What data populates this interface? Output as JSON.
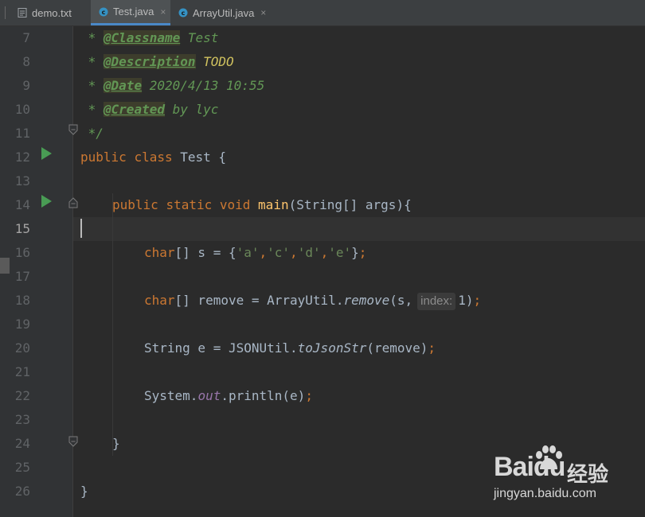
{
  "tabs": [
    {
      "label": "demo.txt",
      "icon": "text-file-icon",
      "active": false
    },
    {
      "label": "Test.java",
      "icon": "java-class-icon",
      "active": true
    },
    {
      "label": "ArrayUtil.java",
      "icon": "java-class-icon",
      "active": false
    }
  ],
  "tab_close_glyph": "×",
  "line_numbers": [
    "7",
    "8",
    "9",
    "10",
    "11",
    "12",
    "13",
    "14",
    "15",
    "16",
    "17",
    "18",
    "19",
    "20",
    "21",
    "22",
    "23",
    "24",
    "25",
    "26"
  ],
  "current_line": "15",
  "code": {
    "l7": {
      "star": " * ",
      "tag": "@Classname",
      "val": " Test"
    },
    "l8": {
      "star": " * ",
      "tag": "@Description",
      "val": " TODO"
    },
    "l9": {
      "star": " * ",
      "tag": "@Date",
      "val": " 2020/4/13 10:55"
    },
    "l10": {
      "star": " * ",
      "tag": "@Created",
      "val": " by lyc"
    },
    "l11": {
      "text": " */"
    },
    "l12": {
      "kw1": "public",
      "kw2": "class",
      "rest": " Test {"
    },
    "l14": {
      "kw1": "public",
      "kw2": "static",
      "kw3": "void",
      "fn": "main",
      "rest": "(String[] args){"
    },
    "l16": {
      "kw": "char",
      "p1": "[] s = {",
      "s1": "'a'",
      "c1": ",",
      "s2": "'c'",
      "c2": ",",
      "s3": "'d'",
      "c3": ",",
      "s4": "'e'",
      "p2": "}",
      "semi": ";"
    },
    "l18": {
      "kw": "char",
      "p1": "[] remove = ArrayUtil.",
      "m": "remove",
      "p2": "(s,",
      "hint": "index:",
      "p3": "1)",
      "semi": ";"
    },
    "l20": {
      "p1": "String e = JSONUtil.",
      "m": "toJsonStr",
      "p2": "(remove)",
      "semi": ";"
    },
    "l22": {
      "p1": "System.",
      "f": "out",
      "p2": ".println(e)",
      "semi": ";"
    },
    "l24": {
      "text": "}"
    },
    "l26": {
      "text": "}"
    }
  },
  "watermark": {
    "logo": "Baidu",
    "cn": "经验",
    "url": "jingyan.baidu.com"
  },
  "colors": {
    "background": "#2b2b2b",
    "keyword": "#cc7832",
    "method": "#ffc66d",
    "string": "#6a8759",
    "doc": "#629755",
    "run": "#499c54"
  }
}
